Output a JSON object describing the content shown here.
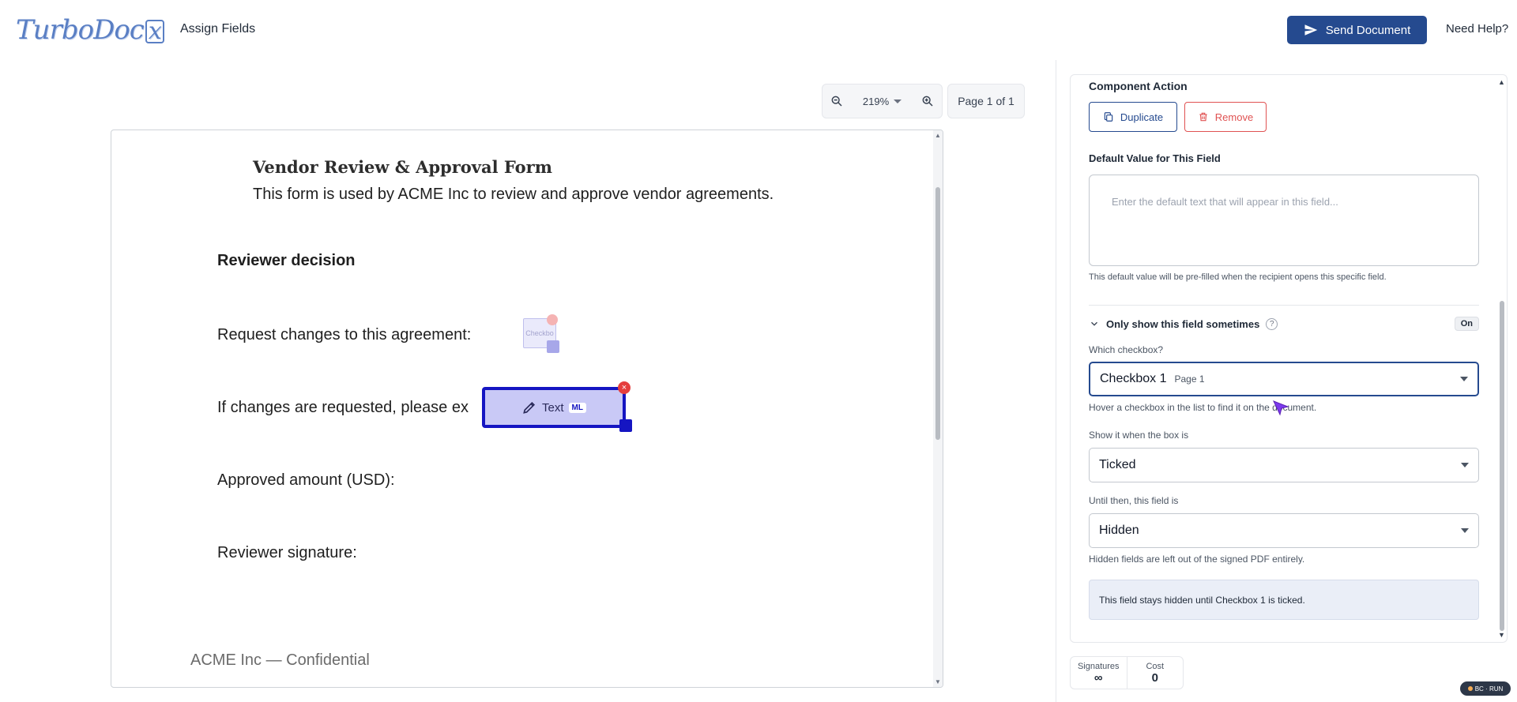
{
  "header": {
    "logo_text": "TurboDoc",
    "logo_x": "x",
    "title": "Assign Fields",
    "send_label": "Send Document",
    "help_label": "Need Help?"
  },
  "toolbar": {
    "zoom": "219%",
    "page": "Page 1 of 1"
  },
  "document": {
    "title": "Vendor Review & Approval Form",
    "subtitle": "This form is used by ACME Inc to review and approve vendor agreements.",
    "section_heading": "Reviewer decision",
    "lines": [
      "Request changes to this agreement:",
      "If changes are requested, please ex",
      "Approved amount (USD):",
      "Reviewer signature:"
    ],
    "footer": "ACME Inc — Confidential",
    "checkbox_field_label": "Checkbo",
    "text_field_label": "Text",
    "text_field_badge": "ML"
  },
  "panel": {
    "component_action_label": "Component Action",
    "duplicate_label": "Duplicate",
    "remove_label": "Remove",
    "default_value_label": "Default Value for This Field",
    "default_value_placeholder": "Enter the default text that will appear in this field...",
    "default_value_help": "This default value will be pre-filled when the recipient opens this specific field.",
    "conditional_label": "Only show this field sometimes",
    "conditional_state": "On",
    "which_checkbox_label": "Which checkbox?",
    "which_checkbox_value": "Checkbox 1",
    "which_checkbox_page": "Page 1",
    "which_checkbox_help": "Hover a checkbox in the list to find it on the document.",
    "show_when_label": "Show it when the box is",
    "show_when_value": "Ticked",
    "until_label": "Until then, this field is",
    "until_value": "Hidden",
    "until_help": "Hidden fields are left out of the signed PDF entirely.",
    "info_text": "This field stays hidden until Checkbox 1 is ticked."
  },
  "stats": {
    "signatures_label": "Signatures",
    "signatures_value": "∞",
    "cost_label": "Cost",
    "cost_value": "0"
  },
  "badge": {
    "text": "BC · RUN"
  },
  "colors": {
    "primary": "#254a8f",
    "danger": "#e05252",
    "field_active": "#1515c2",
    "field_fill": "#c9c9f6"
  }
}
